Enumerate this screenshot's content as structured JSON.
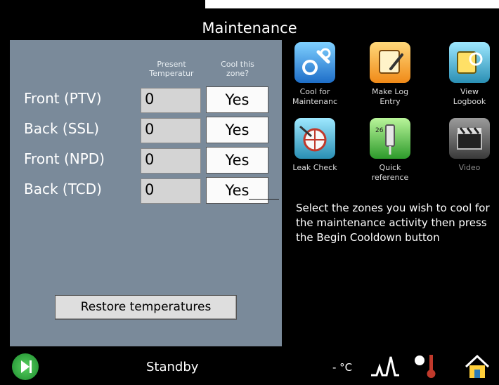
{
  "title": "Maintenance",
  "columns": {
    "present_temp": [
      "Present",
      "Temperatur"
    ],
    "cool_zone": [
      "Cool this",
      "zone?"
    ]
  },
  "zones": [
    {
      "label": "Front (PTV)",
      "temp": "0",
      "cool": "Yes"
    },
    {
      "label": "Back (SSL)",
      "temp": "0",
      "cool": "Yes"
    },
    {
      "label": "Front (NPD)",
      "temp": "0",
      "cool": "Yes"
    },
    {
      "label": "Back (TCD)",
      "temp": "0",
      "cool": "Yes"
    }
  ],
  "restore_label": "Restore temperatures",
  "tiles": [
    {
      "label": [
        "Cool for",
        "Maintenanc"
      ],
      "icon": "wrench-gear-icon"
    },
    {
      "label": [
        "Make Log",
        "Entry"
      ],
      "icon": "log-pen-icon"
    },
    {
      "label": [
        "View",
        "Logbook"
      ],
      "icon": "logbook-icon"
    },
    {
      "label": [
        "Leak Check"
      ],
      "icon": "leak-check-icon"
    },
    {
      "label": [
        "Quick",
        "reference"
      ],
      "icon": "quick-reference-icon"
    },
    {
      "label": [
        "Video"
      ],
      "icon": "video-clapper-icon"
    }
  ],
  "instructions": "Select the zones you wish to cool for the maintenance activity then press the Begin Cooldown button",
  "status": "Standby",
  "temperature_readout": "- °C",
  "colors": {
    "panel": "#7a8a9a",
    "background": "#000000",
    "input_fill": "#d4d4d4",
    "button_fill": "#fbfbfb"
  }
}
